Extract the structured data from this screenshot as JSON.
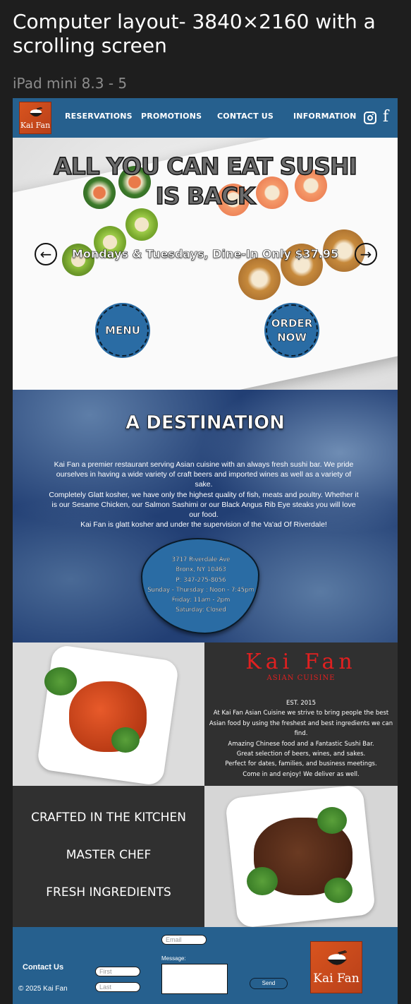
{
  "figma": {
    "title": "Computer layout- 3840×2160 with a scrolling screen",
    "frame_label": "iPad mini 8.3 - 5"
  },
  "nav": {
    "logo_text": "Kai Fan",
    "items": [
      "RESERVATIONS",
      "PROMOTIONS",
      "CONTACT US",
      "INFORMATION"
    ],
    "social": [
      "instagram-icon",
      "facebook-icon"
    ]
  },
  "hero": {
    "headline": "ALL YOU CAN EAT SUSHI IS BACK",
    "subhead": "Mondays & Tuesdays, Dine-In Only $37.95",
    "prev": "←",
    "next": "→",
    "menu_button": "MENU",
    "order_button_line1": "ORDER",
    "order_button_line2": "NOW"
  },
  "destination": {
    "title": "A DESTINATION",
    "body": [
      "Kai Fan a premier restaurant serving Asian cuisine with an always fresh sushi bar. We pride ourselves in having a wide variety of craft beers and imported wines as well as a variety of sake.",
      "Completely Glatt kosher, we have only the highest quality of fish, meats and poultry. Whether it is our Sesame Chicken, our Salmon Sashimi or our Black Angus Rib Eye steaks you will love our food.",
      "Kai Fan is glatt kosher and under the supervision of the Va'ad Of Riverdale!"
    ],
    "info": [
      "3717 Riverdale Ave",
      "Bronx, NY 10463",
      "P: 347-275-8056",
      "Sunday - Thursday : Noon - 7:45pm",
      "Friday:  11am - 2pm",
      "Saturday:  Closed"
    ]
  },
  "about": {
    "logo": "Kai Fan",
    "logo_sub": "ASIAN CUISINE",
    "lines": [
      "EST. 2015",
      "At Kai Fan Asian Cuisine we strive to bring people the best Asian food by using the freshest and best ingredients we can find.",
      "Amazing Chinese food and a Fantastic Sushi Bar.",
      "Great selection of beers, wines, and sakes.",
      "Perfect for dates, families, and business meetings.",
      "Come in and enjoy! We deliver as well."
    ]
  },
  "crafted": [
    "CRAFTED IN THE KITCHEN",
    "MASTER CHEF",
    "FRESH INGREDIENTS"
  ],
  "footer": {
    "contact_label": "Contact Us",
    "copyright": "© 2025 Kai Fan",
    "email_placeholder": "Email",
    "first_placeholder": "First",
    "last_placeholder": "Last",
    "message_label": "Message:",
    "send": "Send",
    "logo_text": "Kai Fan"
  },
  "colors": {
    "brand_blue": "#26608e",
    "button_blue": "#2a6ca4",
    "dark_panel": "#303030",
    "logo_red": "#e02020",
    "logo_orange": "#d9541e"
  }
}
